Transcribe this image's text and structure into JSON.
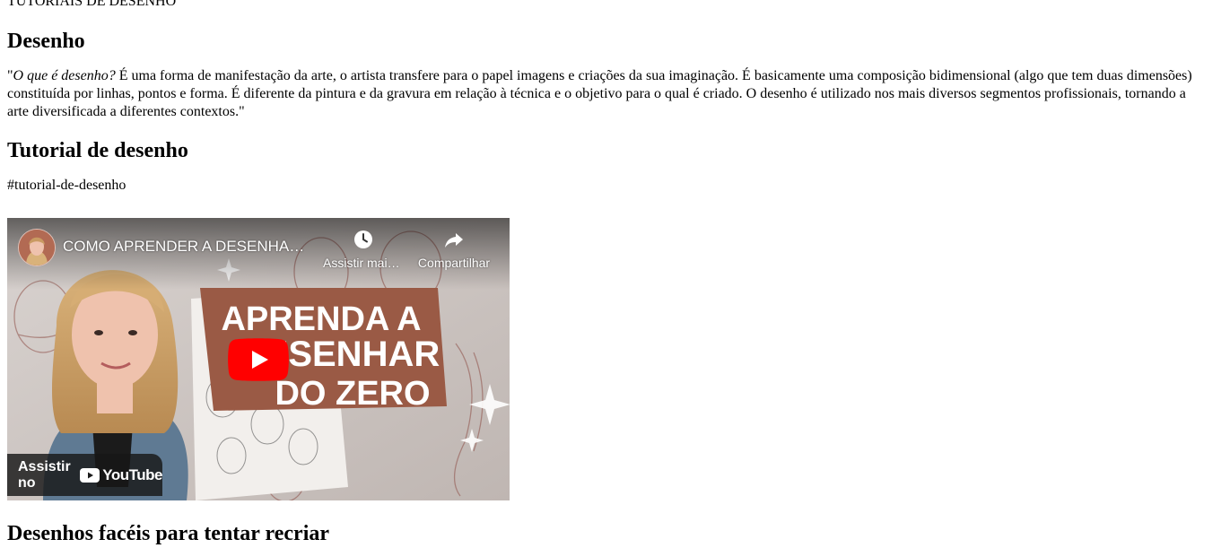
{
  "site": {
    "title": "TUTORIAIS DE DESENHO"
  },
  "section_desenho": {
    "heading": "Desenho",
    "quote_open": "\"",
    "question": "O que é desenho?",
    "body": " É uma forma de manifestação da arte, o artista transfere para o papel imagens e criações da sua imaginação. É basicamente uma composição bidimensional (algo que tem duas dimensões) constituída por linhas, pontos e forma. É diferente da pintura e da gravura em relação à técnica e o objetivo para o qual é criado. O desenho é utilizado nos mais diversos segmentos profissionais, tornando a arte diversificada a diferentes contextos.",
    "quote_close": "\""
  },
  "section_tutorial": {
    "heading": "Tutorial de desenho",
    "anchor": "#tutorial-de-desenho"
  },
  "video": {
    "title": "COMO APRENDER A DESENHAR DO ZERO",
    "watch_later_label": "Assistir mais tarde",
    "share_label": "Compartilhar",
    "watch_on_label": "Assistir no",
    "youtube_word": "YouTube",
    "thumbnail_text": [
      "APRENDA A",
      "DESENHAR",
      "DO ZERO"
    ],
    "icons": [
      "clock-icon",
      "share-icon",
      "play-icon",
      "youtube-logo-icon"
    ],
    "colors": {
      "card_bg": "#9a5a45",
      "play_red": "#ff0000",
      "overlay": "#171717"
    }
  },
  "section_faceis": {
    "heading": "Desenhos facéis para tentar recriar"
  }
}
